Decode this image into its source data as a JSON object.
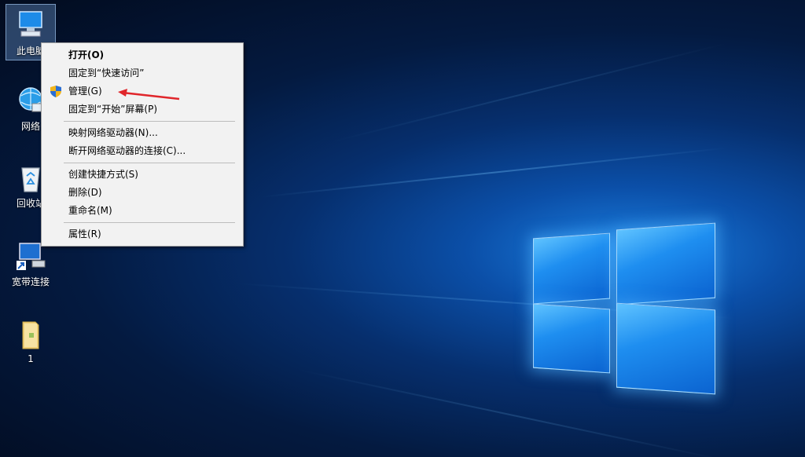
{
  "desktop": {
    "icons": [
      {
        "label": "此电脑",
        "icon": "computer-icon",
        "selected": true
      },
      {
        "label": "网络",
        "icon": "network-icon"
      },
      {
        "label": "回收站",
        "icon": "recycle-bin-icon"
      },
      {
        "label": "宽带连接",
        "icon": "broadband-shortcut-icon"
      },
      {
        "label": "1",
        "icon": "folder-icon"
      }
    ]
  },
  "context_menu": {
    "items": [
      {
        "label": "打开(O)",
        "default": true
      },
      {
        "label": "固定到“快速访问”"
      },
      {
        "label": "管理(G)",
        "icon": "uac-shield-icon",
        "highlighted_by_arrow": true
      },
      {
        "label": "固定到“开始”屏幕(P)"
      },
      {
        "label": "映射网络驱动器(N)..."
      },
      {
        "label": "断开网络驱动器的连接(C)..."
      },
      {
        "label": "创建快捷方式(S)"
      },
      {
        "label": "删除(D)"
      },
      {
        "label": "重命名(M)"
      },
      {
        "label": "属性(R)"
      }
    ]
  },
  "colors": {
    "annotation_arrow": "#e0262b",
    "menu_bg": "#f2f2f2",
    "wallpaper_accent": "#1b7fe0"
  }
}
